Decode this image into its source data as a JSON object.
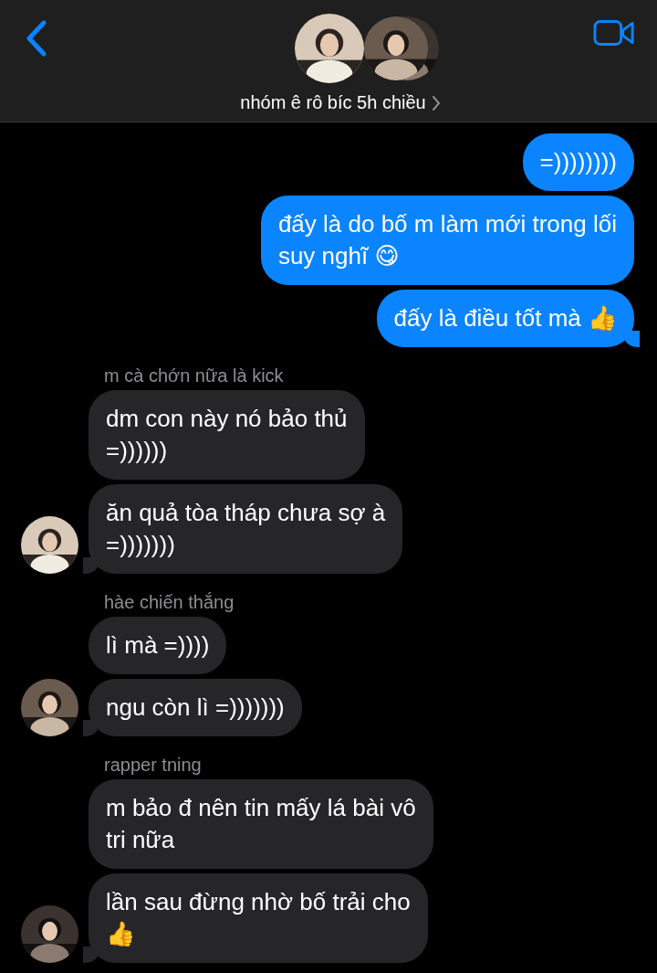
{
  "header": {
    "title": "nhóm ê rô bíc 5h chiều"
  },
  "messages": [
    {
      "kind": "sent",
      "text": "=))))))))",
      "tail": false
    },
    {
      "kind": "sent",
      "text": "đấy là do bố m làm mới trong lối\nsuy nghĩ 😋",
      "tail": false
    },
    {
      "kind": "sent",
      "text": "đấy là điều tốt mà 👍",
      "tail": true
    },
    {
      "kind": "name",
      "text": "m cà chớn nữa là kick"
    },
    {
      "kind": "received",
      "text": "dm con này nó bảo thủ\n=))))))",
      "avatar": false,
      "tail": false
    },
    {
      "kind": "received",
      "text": "ăn quả tòa tháp chưa sợ à\n=)))))))",
      "avatar": true,
      "tail": true
    },
    {
      "kind": "name",
      "text": "hàe chiến thắng"
    },
    {
      "kind": "received",
      "text": "lì mà =))))",
      "avatar": false,
      "tail": false
    },
    {
      "kind": "received",
      "text": "ngu còn lì =)))))))",
      "avatar": true,
      "tail": true
    },
    {
      "kind": "name",
      "text": "rapper tning"
    },
    {
      "kind": "received",
      "text": "m bảo đ nên tin mấy lá bài vô\ntri nữa",
      "avatar": false,
      "tail": false
    },
    {
      "kind": "received",
      "text": "lần sau đừng nhờ bố trải cho\n👍",
      "avatar": true,
      "tail": true
    }
  ]
}
